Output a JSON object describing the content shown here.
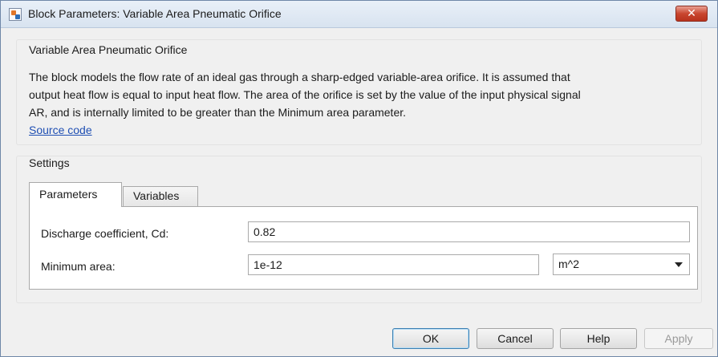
{
  "window": {
    "title": "Block Parameters: Variable Area Pneumatic Orifice",
    "close_symbol": "✕"
  },
  "description_group": {
    "title": "Variable Area Pneumatic Orifice",
    "text_lines": [
      "The block models the flow rate of an ideal gas through a sharp-edged variable-area orifice. It is assumed that",
      "output heat flow is equal to input heat flow. The area of the orifice is set by the value of the input physical signal",
      "AR, and is internally limited to be greater than the Minimum area parameter."
    ],
    "link": "Source code"
  },
  "settings": {
    "title": "Settings",
    "tabs": [
      {
        "label": "Parameters",
        "active": true
      },
      {
        "label": "Variables",
        "active": false
      }
    ],
    "params": {
      "discharge": {
        "label": "Discharge coefficient, Cd:",
        "value": "0.82"
      },
      "min_area": {
        "label": "Minimum area:",
        "value": "1e-12",
        "unit": "m^2"
      }
    }
  },
  "buttons": {
    "ok": "OK",
    "cancel": "Cancel",
    "help": "Help",
    "apply": "Apply"
  },
  "icons": {
    "app": "block-parameters-icon",
    "close": "close-icon",
    "dropdown": "chevron-down-icon"
  },
  "colors": {
    "link": "#1f4fb3",
    "close_button": "#c9462f",
    "ok_border": "#3c7fb1"
  }
}
